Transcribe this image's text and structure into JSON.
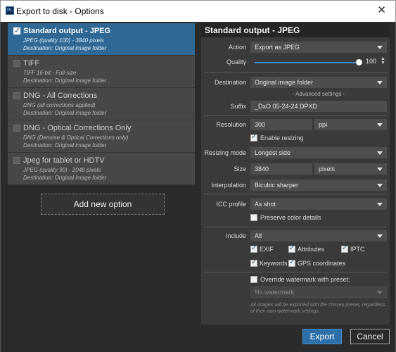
{
  "window": {
    "app_icon_text": "PL",
    "title": "Export to disk - Options",
    "close_glyph": "✕"
  },
  "options": [
    {
      "title": "Standard output - JPEG",
      "line1": "JPEG (quality 100) - 3840 pixels",
      "line2": "Destination: Original image folder"
    },
    {
      "title": "TIFF",
      "line1": "TIFF 16-bit - Full size",
      "line2": "Destination: Original image folder"
    },
    {
      "title": "DNG  - All Corrections",
      "line1": "DNG (all corrections applied)",
      "line2": "Destination: Original image folder"
    },
    {
      "title": "DNG  - Optical Corrections Only",
      "line1": "DNG (Denoise & Optical Corrections only)",
      "line2": "Destination: Original image folder"
    },
    {
      "title": "Jpeg for tablet or HDTV",
      "line1": "JPEG (quality 90) - 2048 pixels",
      "line2": "Destination: Original image folder"
    }
  ],
  "add_option_label": "Add new option",
  "panel": {
    "title": "Standard output - JPEG",
    "action_label": "Action",
    "action_value": "Export as JPEG",
    "quality_label": "Quality",
    "quality_value": "100",
    "quality_fraction": 1.0,
    "destination_label": "Destination",
    "destination_value": "Original image folder",
    "advanced_settings": "- Advanced settings -",
    "suffix_label": "Suffix",
    "suffix_value": "_DxO 05-24-24 DPXD",
    "resolution_label": "Resolution",
    "resolution_value": "300",
    "resolution_unit": "ppi",
    "enable_resizing_label": "Enable resizing",
    "resizing_mode_label": "Resizing mode",
    "resizing_mode_value": "Longest side",
    "size_label": "Size",
    "size_value": "3840",
    "size_unit": "pixels",
    "interpolation_label": "Interpolation",
    "interpolation_value": "Bicubic sharper",
    "icc_label": "ICC profile",
    "icc_value": "As shot",
    "preserve_color_label": "Preserve color details",
    "include_label": "Include",
    "include_value": "All",
    "exif_label": "EXIF",
    "attributes_label": "Attributes",
    "iptc_label": "IPTC",
    "keywords_label": "Keywords",
    "gps_label": "GPS coordinates",
    "watermark_label": "Override watermark with preset:",
    "watermark_value": "No watermark",
    "watermark_note": "All images will be exported with the chosen preset, regardless of their own watermark settings."
  },
  "buttons": {
    "export": "Export",
    "cancel": "Cancel"
  },
  "colors": {
    "accent": "#2f6894",
    "export_button": "#2d6fa8",
    "slider": "#3d8ed1"
  }
}
